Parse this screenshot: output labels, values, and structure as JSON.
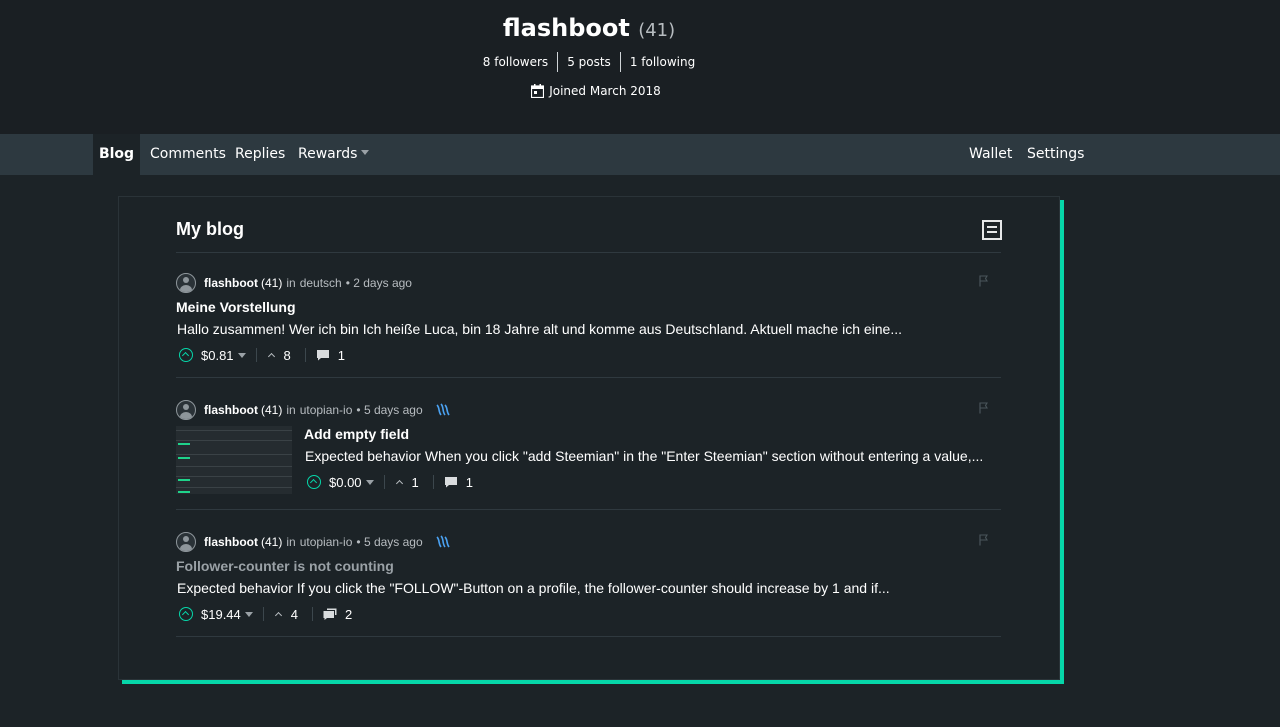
{
  "profile": {
    "name": "flashboot",
    "reputation": "(41)",
    "followers": "8 followers",
    "posts": "5 posts",
    "following": "1 following",
    "joined": "Joined March 2018"
  },
  "nav": {
    "blog": "Blog",
    "comments": "Comments",
    "replies": "Replies",
    "rewards": "Rewards",
    "wallet": "Wallet",
    "settings": "Settings"
  },
  "blog": {
    "title": "My blog",
    "posts": [
      {
        "author": "flashboot",
        "rep": "(41)",
        "in": "in",
        "category": "deutsch",
        "time": "• 2 days ago",
        "title": "Meine Vorstellung",
        "body": "Hallo zusammen! Wer ich bin Ich heiße Luca, bin 18 Jahre alt und komme aus Deutschland. Aktuell mache ich eine...",
        "payout": "$0.81",
        "votes": "8",
        "comments": "1"
      },
      {
        "author": "flashboot",
        "rep": "(41)",
        "in": "in",
        "category": "utopian-io",
        "time": "• 5 days ago",
        "title": "Add empty field",
        "body": "Expected behavior When you click \"add Steemian\" in the \"Enter Steemian\" section without entering a value,...",
        "payout": "$0.00",
        "votes": "1",
        "comments": "1"
      },
      {
        "author": "flashboot",
        "rep": "(41)",
        "in": "in",
        "category": "utopian-io",
        "time": "• 5 days ago",
        "title": "Follower-counter is not counting",
        "body": "Expected behavior If you click the \"FOLLOW\"-Button on a profile, the follower-counter should increase by 1 and if...",
        "payout": "$19.44",
        "votes": "4",
        "comments": "2"
      }
    ]
  },
  "colors": {
    "accent": "#06d6a9",
    "background": "#1c2327",
    "header": "#1a1f23",
    "nav": "#2d3940"
  },
  "icons": {
    "calendar": "calendar-icon",
    "flag": "flag-icon",
    "upvote": "upvote-icon",
    "comment": "comment-icon",
    "steem": "steem-icon",
    "layout": "layout-toggle-icon"
  }
}
